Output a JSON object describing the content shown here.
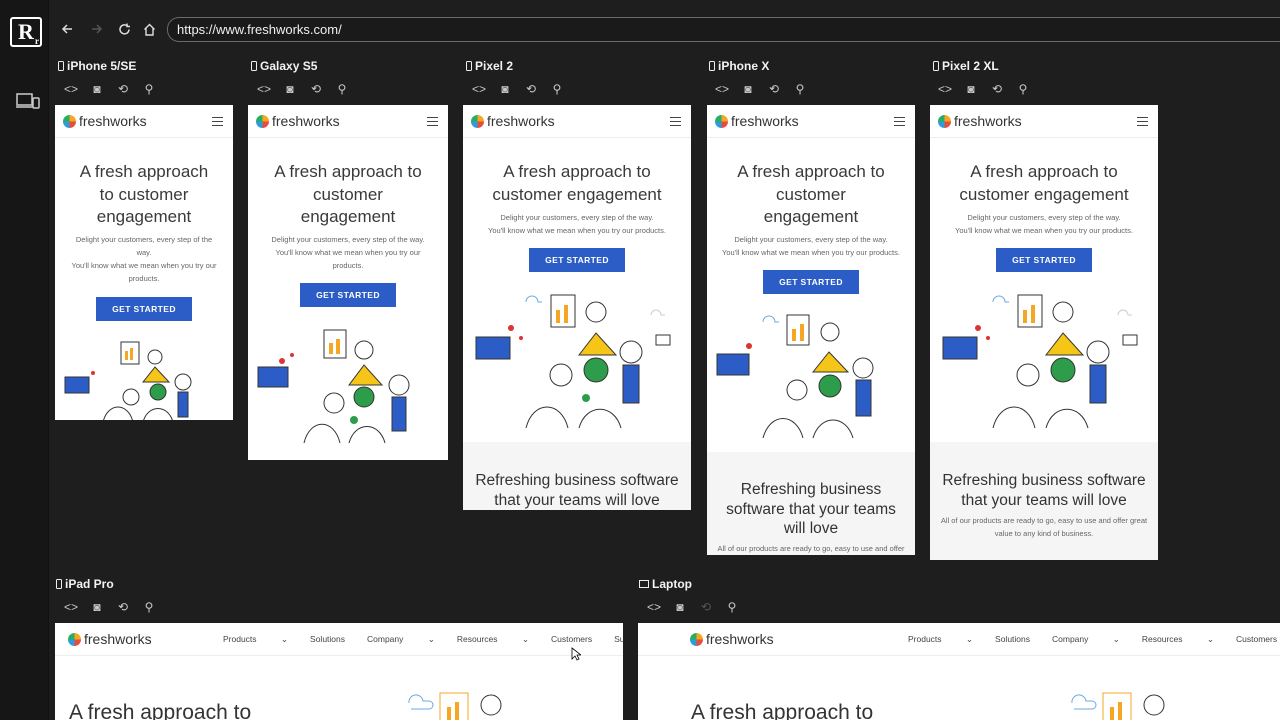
{
  "browser": {
    "url": "https://www.freshworks.com/",
    "nav_icons": [
      "back-icon",
      "forward-icon",
      "reload-icon",
      "home-icon"
    ]
  },
  "sidebar": {
    "logo_text": "R",
    "logo_sub": "r",
    "devices_icon": "devices-icon"
  },
  "devices": [
    {
      "label": "iPhone 5/SE"
    },
    {
      "label": "Galaxy S5"
    },
    {
      "label": "Pixel 2"
    },
    {
      "label": "iPhone X"
    },
    {
      "label": "Pixel 2 XL"
    },
    {
      "label": "iPad Pro"
    },
    {
      "label": "Laptop"
    }
  ],
  "device_tools": [
    "code-icon",
    "screenshot-icon",
    "rotate-icon",
    "sync-icon"
  ],
  "site": {
    "brand": "freshworks",
    "hero_title_lines_5": [
      "A fresh approach",
      "to customer",
      "engagement"
    ],
    "hero_title_lines_s5": [
      "A fresh approach to",
      "customer",
      "engagement"
    ],
    "hero_title_lines_p2": [
      "A fresh approach to",
      "customer engagement"
    ],
    "hero_title_lines_x": [
      "A fresh approach to",
      "customer",
      "engagement"
    ],
    "hero_sub_5": [
      "Delight your customers, every step of the",
      "way.",
      "You'll know what we mean when you try our",
      "products."
    ],
    "hero_sub_s5": [
      "Delight your customers, every step of the way.",
      "You'll know what we mean when you try our",
      "products."
    ],
    "hero_sub_p2": [
      "Delight your customers, every step of the way.",
      "You'll know what we mean when you try our products."
    ],
    "hero_sub_x": [
      "Delight your customers, every step of the way.",
      "You'll know what we mean when you try our products."
    ],
    "cta": "GET STARTED",
    "section_title_p2": [
      "Refreshing business software",
      "that your teams will love"
    ],
    "section_title_x": [
      "Refreshing business",
      "software that your teams",
      "will love"
    ],
    "section_title_xl": [
      "Refreshing business software",
      "that your teams will love"
    ],
    "section_sub_x": "All of our products are ready to go, easy to use and offer",
    "section_sub_xl": [
      "All of our products are ready to go, easy to use and offer great",
      "value to any kind of business."
    ],
    "desktop_nav": [
      "Products",
      "Solutions",
      "Company",
      "Resources",
      "Customers",
      "Support"
    ],
    "desktop_title": "A fresh approach to"
  },
  "colors": {
    "cta": "#2c5cc5",
    "background": "#1e1e1e"
  }
}
